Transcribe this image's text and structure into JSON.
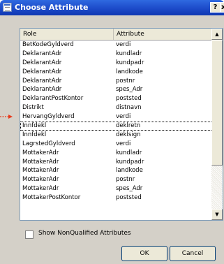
{
  "window": {
    "title": "Choose Attribute",
    "help_label": "?",
    "close_label": "x"
  },
  "table": {
    "columns": [
      "Role",
      "Attribute"
    ],
    "rows": [
      {
        "role": "BetKodeGyldverd",
        "attribute": "verdi"
      },
      {
        "role": "DeklarantAdr",
        "attribute": "kundladr"
      },
      {
        "role": "DeklarantAdr",
        "attribute": "kundpadr"
      },
      {
        "role": "DeklarantAdr",
        "attribute": "landkode"
      },
      {
        "role": "DeklarantAdr",
        "attribute": "postnr"
      },
      {
        "role": "DeklarantAdr",
        "attribute": "spes_Adr"
      },
      {
        "role": "DeklarantPostKontor",
        "attribute": "poststed"
      },
      {
        "role": "Distrikt",
        "attribute": "distnavn"
      },
      {
        "role": "HervangGyldverd",
        "attribute": "verdi"
      },
      {
        "role": "Innfdekl",
        "attribute": "deklretn"
      },
      {
        "role": "Innfdekl",
        "attribute": "deklsign"
      },
      {
        "role": "LagrstedGyldverd",
        "attribute": "verdi"
      },
      {
        "role": "MottakerAdr",
        "attribute": "kundladr"
      },
      {
        "role": "MottakerAdr",
        "attribute": "kundpadr"
      },
      {
        "role": "MottakerAdr",
        "attribute": "landkode"
      },
      {
        "role": "MottakerAdr",
        "attribute": "postnr"
      },
      {
        "role": "MottakerAdr",
        "attribute": "spes_Adr"
      },
      {
        "role": "MottakerPostKontor",
        "attribute": "poststed"
      }
    ],
    "selected_index": 9
  },
  "options": {
    "show_nonqualified_label": "Show NonQualified Attributes",
    "show_nonqualified_checked": false
  },
  "buttons": {
    "ok": "OK",
    "cancel": "Cancel"
  },
  "colors": {
    "title_bar": "#1b48c7",
    "dialog_bg": "#d4d0c8",
    "pointer_arrow": "#e8391a"
  },
  "icons": {
    "window": "dialog-icon",
    "scroll_up": "arrow-up-icon",
    "scroll_down": "arrow-down-icon",
    "pointer": "red-arrow-icon"
  }
}
